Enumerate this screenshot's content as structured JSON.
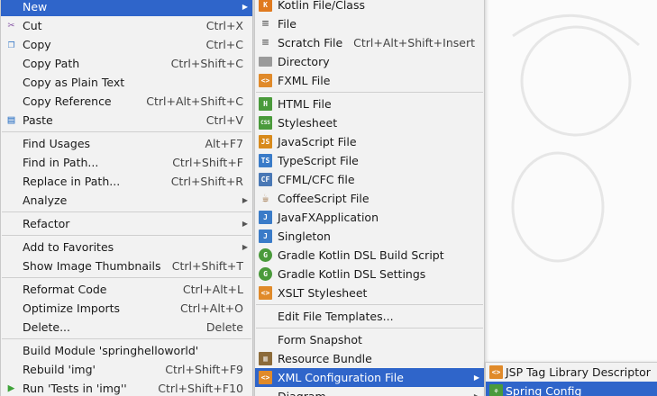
{
  "main_menu": {
    "items": [
      {
        "label": "New",
        "shortcut": "",
        "submenu": true,
        "selected": true,
        "icon": ""
      },
      {
        "label": "Cut",
        "shortcut": "Ctrl+X",
        "icon": "scissors-icon"
      },
      {
        "label": "Copy",
        "shortcut": "Ctrl+C",
        "icon": "copy-icon"
      },
      {
        "label": "Copy Path",
        "shortcut": "Ctrl+Shift+C"
      },
      {
        "label": "Copy as Plain Text",
        "shortcut": ""
      },
      {
        "label": "Copy Reference",
        "shortcut": "Ctrl+Alt+Shift+C"
      },
      {
        "label": "Paste",
        "shortcut": "Ctrl+V",
        "icon": "paste-icon"
      },
      {
        "label": "Find Usages",
        "shortcut": "Alt+F7"
      },
      {
        "label": "Find in Path...",
        "shortcut": "Ctrl+Shift+F"
      },
      {
        "label": "Replace in Path...",
        "shortcut": "Ctrl+Shift+R"
      },
      {
        "label": "Analyze",
        "shortcut": "",
        "submenu": true
      },
      {
        "label": "Refactor",
        "shortcut": "",
        "submenu": true
      },
      {
        "label": "Add to Favorites",
        "shortcut": "",
        "submenu": true
      },
      {
        "label": "Show Image Thumbnails",
        "shortcut": "Ctrl+Shift+T"
      },
      {
        "label": "Reformat Code",
        "shortcut": "Ctrl+Alt+L"
      },
      {
        "label": "Optimize Imports",
        "shortcut": "Ctrl+Alt+O"
      },
      {
        "label": "Delete...",
        "shortcut": "Delete"
      },
      {
        "label": "Build Module 'springhelloworld'",
        "shortcut": ""
      },
      {
        "label": "Rebuild 'img'",
        "shortcut": "Ctrl+Shift+F9"
      },
      {
        "label": "Run 'Tests in 'img''",
        "shortcut": "Ctrl+Shift+F10",
        "icon": "run-icon"
      }
    ]
  },
  "new_submenu": {
    "items": [
      {
        "label": "Kotlin File/Class",
        "icon_text": "K",
        "icon_color": "#e07a1f"
      },
      {
        "label": "File",
        "icon_text": "≡"
      },
      {
        "label": "Scratch File",
        "shortcut": "Ctrl+Alt+Shift+Insert",
        "icon_text": "≡"
      },
      {
        "label": "Directory",
        "icon_text": "▬",
        "icon_color": "#8c8c8c"
      },
      {
        "label": "FXML File",
        "icon_text": "<>",
        "icon_color": "#e08a2a"
      },
      {
        "label": "HTML File",
        "icon_text": "H",
        "icon_color": "#4a9a3b"
      },
      {
        "label": "Stylesheet",
        "icon_text": "CSS",
        "icon_color": "#4a9a3b"
      },
      {
        "label": "JavaScript File",
        "icon_text": "JS",
        "icon_color": "#d88a1c"
      },
      {
        "label": "TypeScript File",
        "icon_text": "TS",
        "icon_color": "#3a7bc8"
      },
      {
        "label": "CFML/CFC file",
        "icon_text": "CF",
        "icon_color": "#4a78b5"
      },
      {
        "label": "CoffeeScript File",
        "icon_text": "☕",
        "icon_color": "#9a6a3a"
      },
      {
        "label": "JavaFXApplication",
        "icon_text": "J",
        "icon_color": "#3a7bc8"
      },
      {
        "label": "Singleton",
        "icon_text": "J",
        "icon_color": "#3a7bc8"
      },
      {
        "label": "Gradle Kotlin DSL Build Script",
        "icon_text": "G",
        "icon_color": "#4a9a3b"
      },
      {
        "label": "Gradle Kotlin DSL Settings",
        "icon_text": "G",
        "icon_color": "#4a9a3b"
      },
      {
        "label": "XSLT Stylesheet",
        "icon_text": "<>",
        "icon_color": "#e08a2a"
      },
      {
        "label": "Edit File Templates..."
      },
      {
        "label": "Form Snapshot"
      },
      {
        "label": "Resource Bundle",
        "icon_text": "▥",
        "icon_color": "#8c6b3a"
      },
      {
        "label": "XML Configuration File",
        "submenu": true,
        "selected": true,
        "icon_text": "<>",
        "icon_color": "#e08a2a"
      },
      {
        "label": "Diagram",
        "submenu": true
      }
    ]
  },
  "xml_submenu": {
    "items": [
      {
        "label": "JSP Tag Library Descriptor",
        "icon_text": "<>",
        "icon_color": "#e08a2a"
      },
      {
        "label": "Spring Config",
        "selected": true,
        "icon_text": "⚘",
        "icon_color": "#4a9a3b"
      }
    ]
  },
  "colors": {
    "selection": "#2f65ca",
    "menu_bg": "#f2f2f2"
  }
}
